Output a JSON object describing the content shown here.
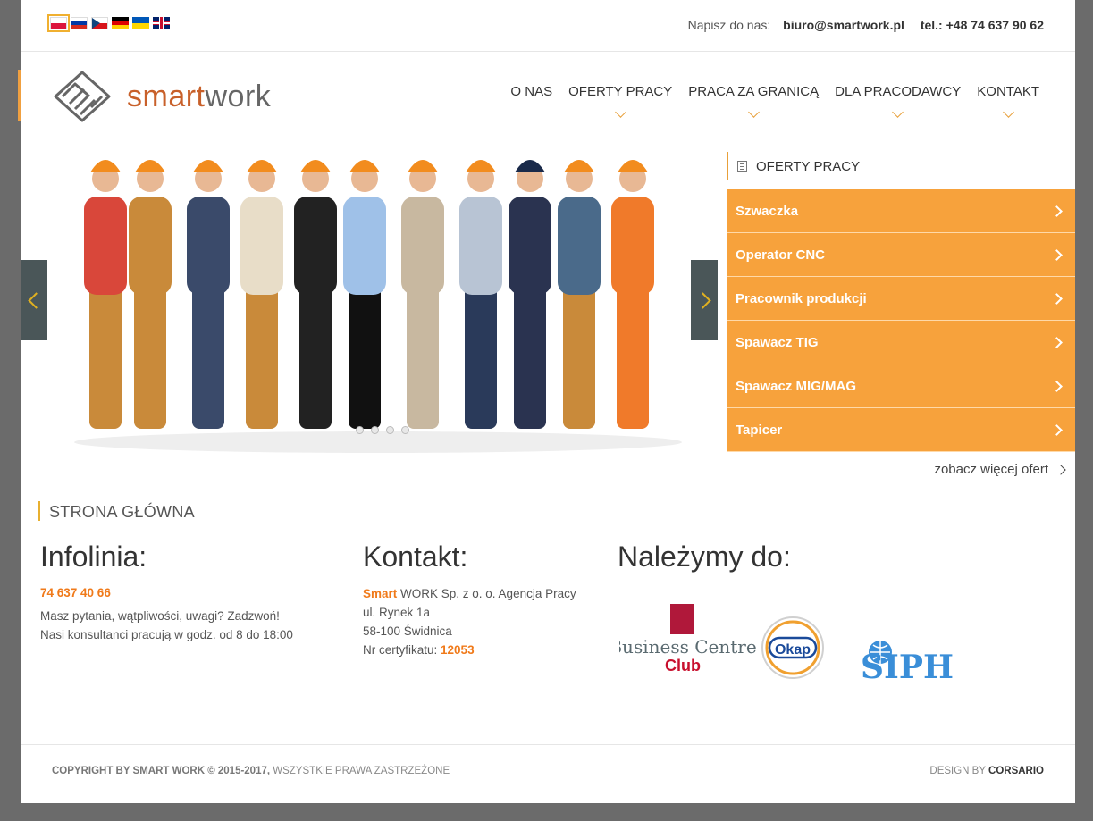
{
  "topbar": {
    "flags": [
      {
        "name": "pl",
        "active": true
      },
      {
        "name": "ru",
        "active": false
      },
      {
        "name": "cz",
        "active": false
      },
      {
        "name": "de",
        "active": false
      },
      {
        "name": "ua",
        "active": false
      },
      {
        "name": "gb",
        "active": false
      }
    ],
    "contact_label": "Napisz do nas:",
    "email": "biuro@smartwork.pl",
    "phone": "tel.: +48 74 637 90 62"
  },
  "header": {
    "logo_part1": "smart",
    "logo_part2": "work",
    "nav": [
      {
        "label": "O NAS",
        "has_submenu": false
      },
      {
        "label": "OFERTY PRACY",
        "has_submenu": true
      },
      {
        "label": "PRACA ZA GRANICĄ",
        "has_submenu": true
      },
      {
        "label": "DLA PRACODAWCY",
        "has_submenu": true
      },
      {
        "label": "KONTAKT",
        "has_submenu": true
      }
    ]
  },
  "offers": {
    "title": "OFERTY PRACY",
    "items": [
      "Szwaczka",
      "Operator CNC",
      "Pracownik produkcji",
      "Spawacz TIG",
      "Spawacz MIG/MAG",
      "Tapicer"
    ],
    "more_label": "zobacz więcej ofert"
  },
  "breadcrumb": "STRONA GŁÓWNA",
  "infolinia": {
    "title": "Infolinia:",
    "phone": "74 637 40 66",
    "line1": "Masz pytania, wątpliwości, uwagi? Zadzwoń!",
    "line2": "Nasi konsultanci pracują w godz. od 8 do 18:00"
  },
  "kontakt": {
    "title": "Kontakt:",
    "company_highlight": "Smart",
    "company_rest": " WORK Sp. z o. o. Agencja Pracy",
    "street": "ul. Rynek 1a",
    "city": "58-100 Świdnica",
    "cert_label": "Nr certyfikatu: ",
    "cert_number": "12053"
  },
  "nalezymy": {
    "title": "Należymy do:",
    "logos": [
      {
        "line1": "Business Centre",
        "line2": "Club"
      },
      {
        "line1": "Okap"
      },
      {
        "line1": "SIPH"
      }
    ]
  },
  "footer": {
    "copyright_bold": "COPYRIGHT BY SMART WORK © 2015-2017,",
    "copyright_rest": " WSZYSTKIE PRAWA ZASTRZEŻONE",
    "design_label": "DESIGN BY ",
    "design_name": "CORSARIO"
  },
  "colors": {
    "accent": "#f7a23c",
    "orange_text": "#f07a1a",
    "slider_arrow_bg": "#4a5658",
    "logo_orange": "#c8602a"
  }
}
